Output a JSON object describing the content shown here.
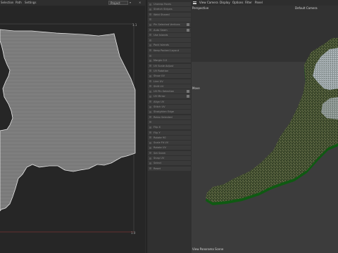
{
  "uv_editor": {
    "menu": [
      "Selection",
      "Path",
      "Settings"
    ],
    "preset": "Project",
    "tick_top": "1.1",
    "tick_bottom": "1.0"
  },
  "settings_panel": {
    "rows": [
      {
        "label": "Unwrap Faces",
        "checked": false
      },
      {
        "label": "Stretch Stripes",
        "checked": false
      },
      {
        "label": "Weld Shared",
        "checked": false
      },
      {
        "label": "",
        "checked": false
      },
      {
        "label": "Pin Selected Vertices",
        "checked": true
      },
      {
        "label": "Auto Seam",
        "checked": true
      },
      {
        "label": "Use Islands",
        "checked": false
      },
      {
        "label": "",
        "checked": false
      },
      {
        "label": "Pack Islands",
        "checked": false
      },
      {
        "label": "Keep Packed Layout",
        "checked": false
      },
      {
        "label": "",
        "checked": false
      },
      {
        "label": "Margin 0.0",
        "checked": false
      },
      {
        "label": "UV Scale Adjust",
        "checked": false
      },
      {
        "label": "UV Rotation",
        "checked": false
      },
      {
        "label": "Show UV",
        "checked": false
      },
      {
        "label": "Line UV",
        "checked": false
      },
      {
        "label": "Shift UV",
        "checked": false
      },
      {
        "label": "UV Pin Selection",
        "checked": true
      },
      {
        "label": "UV Mirror",
        "checked": true
      },
      {
        "label": "Align UV",
        "checked": false
      },
      {
        "label": "Stitch UV",
        "checked": false
      },
      {
        "label": "Straighten Edge",
        "checked": false
      },
      {
        "label": "Relax Selected",
        "checked": false
      },
      {
        "label": "",
        "checked": false
      },
      {
        "label": "Flip X",
        "checked": false
      },
      {
        "label": "Flip Y",
        "checked": false
      },
      {
        "label": "Rotate 90",
        "checked": false
      },
      {
        "label": "Scale Fit UV",
        "checked": false
      },
      {
        "label": "Rotate UV",
        "checked": false
      },
      {
        "label": "Set Seam",
        "checked": false
      },
      {
        "label": "Snap UV",
        "checked": false
      },
      {
        "label": "Select",
        "checked": false
      },
      {
        "label": "Reset",
        "checked": false
      }
    ]
  },
  "viewport": {
    "menu": [
      "View",
      "Camera",
      "Display",
      "Options",
      "Filter",
      "Panel"
    ],
    "label_top_left": "Perspective",
    "camera_label": "Default Camera",
    "side_label": "Move",
    "status": "View Panorama Scene"
  },
  "colors": {
    "uv_fill": "#7a7a7a",
    "uv_outline": "#e6e6e6",
    "viewport_bg": "#3a3a3a",
    "land_green": "#0f5a12",
    "urban_gray": "#a8b3b8"
  }
}
